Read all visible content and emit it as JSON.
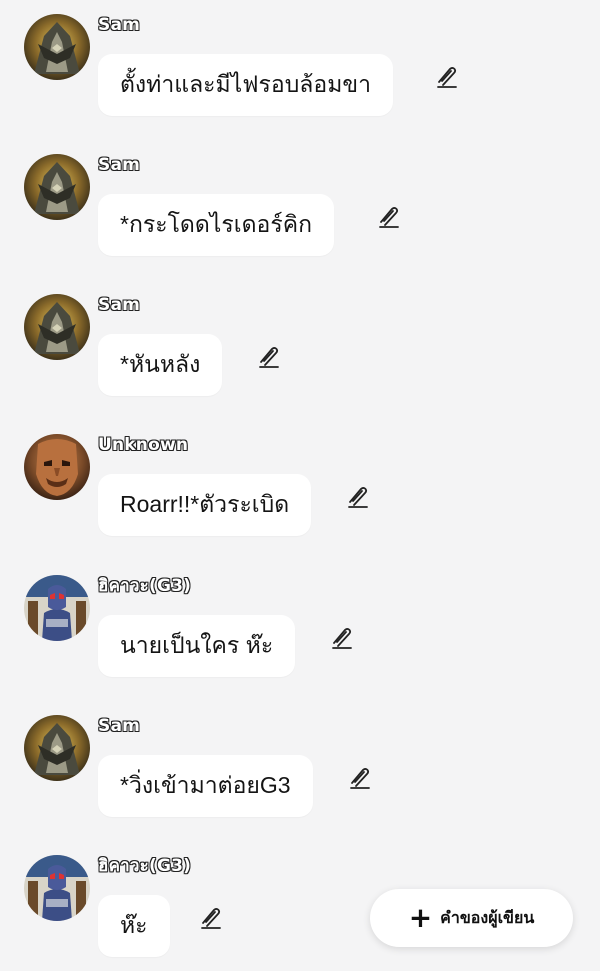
{
  "messages": [
    {
      "author": "Sam",
      "avatar": "mech-warrior-avatar",
      "text": "ตั้งท่าและมีไฟรอบล้อมขา",
      "edit_icon": "edit-pen-icon"
    },
    {
      "author": "Sam",
      "avatar": "mech-warrior-avatar",
      "text": "*กระโดดไรเดอร์คิก",
      "edit_icon": "edit-pen-icon"
    },
    {
      "author": "Sam",
      "avatar": "mech-warrior-avatar",
      "text": "*หันหลัง",
      "edit_icon": "edit-pen-icon"
    },
    {
      "author": "Unknown",
      "avatar": "monster-avatar",
      "text": "Roarr!!*ตัวระเบิด",
      "edit_icon": "edit-pen-icon"
    },
    {
      "author": "ฮิคาวะ(G3)",
      "avatar": "blue-armor-avatar",
      "text": "นายเป็นใคร ห๊ะ",
      "edit_icon": "edit-pen-icon"
    },
    {
      "author": "Sam",
      "avatar": "mech-warrior-avatar",
      "text": "*วิ่งเข้ามาต่อยG3",
      "edit_icon": "edit-pen-icon"
    },
    {
      "author": "ฮิคาวะ(G3)",
      "avatar": "blue-armor-avatar",
      "text": "ห๊ะ",
      "edit_icon": "edit-pen-icon"
    }
  ],
  "fab": {
    "icon": "plus-icon",
    "plus": "+",
    "label": "คำของผู้เขียน"
  },
  "colors": {
    "background": "#f4f4f5",
    "bubble": "#ffffff",
    "text": "#141414"
  }
}
